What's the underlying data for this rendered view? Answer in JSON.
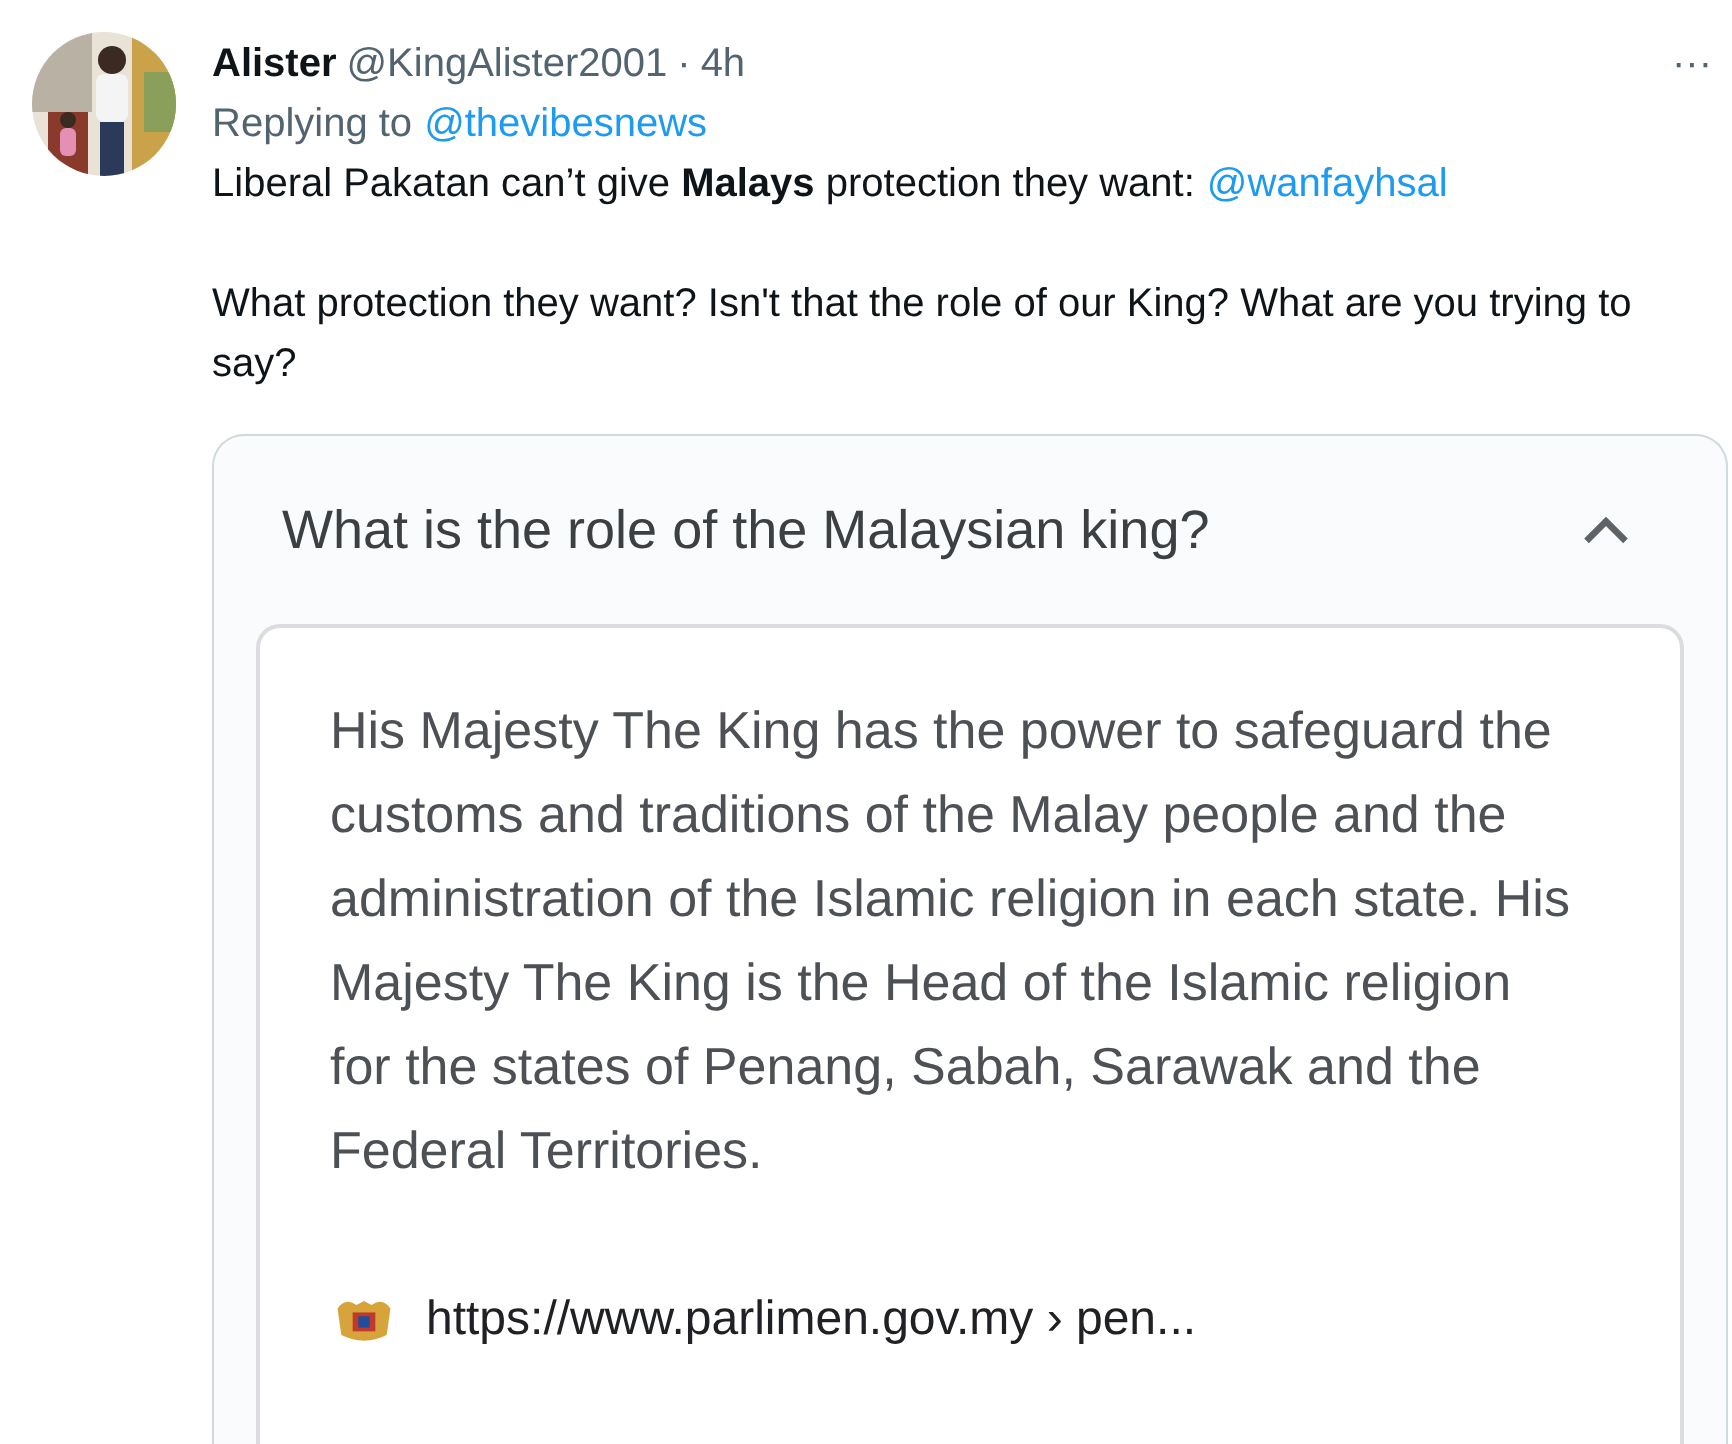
{
  "tweet": {
    "name": "Alister",
    "handle": "@KingAlister2001",
    "separator": "·",
    "time": "4h",
    "more": "···",
    "reply_prefix": "Replying to",
    "reply_to": "@thevibesnews",
    "line_1": "Liberal Pakatan can’t give **Malays** protection they want:",
    "mention": "@wanfayhsal",
    "paragraph_2": "What protection they want? Isn't that the role of our King? What are you trying to say?"
  },
  "embedded_screenshot": {
    "question": "What is the role of the Malaysian king?",
    "expanded": true,
    "answer": "His Majesty The King has the power to safeguard the customs and traditions of the Malay people and the administration of the Islamic religion in each state. His Majesty The King is the Head of the Islamic religion for the states of Penang, Sabah, Sarawak and the Federal Territories.",
    "source_url": "https://www.parlimen.gov.my › pen..."
  }
}
